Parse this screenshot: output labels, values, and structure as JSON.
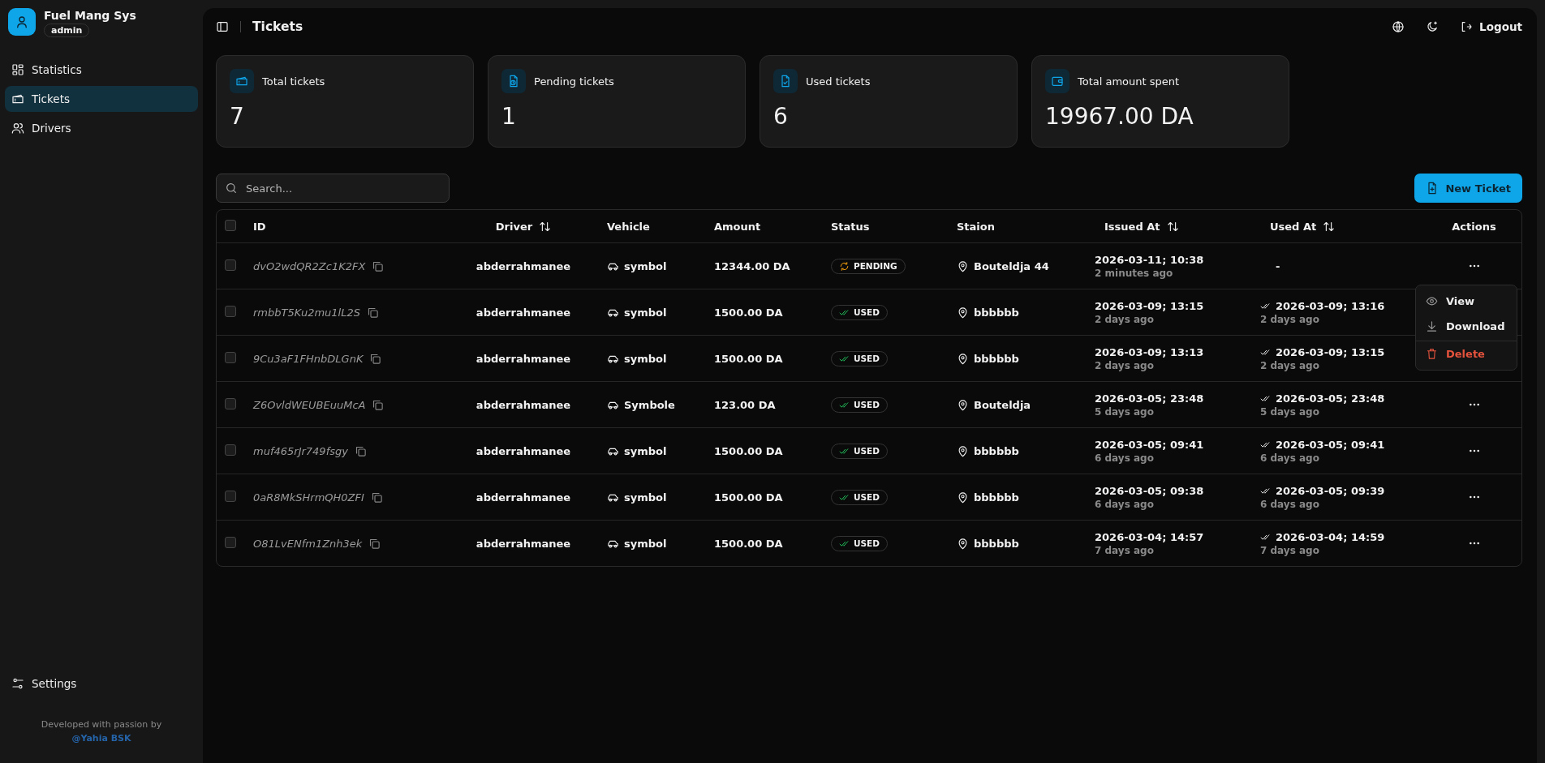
{
  "app": {
    "title": "Fuel Mang Sys",
    "role": "admin"
  },
  "sidebar": {
    "items": [
      {
        "label": "Statistics",
        "kind": "grid",
        "selected": false
      },
      {
        "label": "Tickets",
        "kind": "ticket",
        "selected": true
      },
      {
        "label": "Drivers",
        "kind": "users",
        "selected": false
      }
    ],
    "settings": "Settings",
    "footer": "Developed with passion by",
    "footer_link": "@Yahia BSK"
  },
  "header": {
    "title": "Tickets",
    "logout": "Logout"
  },
  "stats": [
    {
      "label": "Total tickets",
      "value": "7",
      "kind": "ticket"
    },
    {
      "label": "Pending tickets",
      "value": "1",
      "kind": "pending"
    },
    {
      "label": "Used tickets",
      "value": "6",
      "kind": "used"
    },
    {
      "label": "Total amount spent",
      "value": "19967.00 DA",
      "kind": "wallet"
    }
  ],
  "search": {
    "placeholder": "Search..."
  },
  "new_button": "New Ticket",
  "table": {
    "all_checked": false,
    "columns": [
      {
        "label": "ID",
        "sortable": false
      },
      {
        "label": "Driver",
        "sortable": true
      },
      {
        "label": "Vehicle",
        "sortable": false
      },
      {
        "label": "Amount",
        "sortable": false
      },
      {
        "label": "Status",
        "sortable": false
      },
      {
        "label": "Staion",
        "sortable": false
      },
      {
        "label": "Issued At",
        "sortable": true
      },
      {
        "label": "Used At",
        "sortable": true
      },
      {
        "label": "Actions",
        "sortable": false
      }
    ],
    "rows": [
      {
        "checked": false,
        "id": "dvO2wdQR2Zc1K2FX",
        "driver": "abderrahmanee",
        "vehicle": "symbol",
        "amount": "12344.00 DA",
        "status": {
          "kind": "pending",
          "label": "PENDING"
        },
        "station": "Bouteldja 44",
        "issued": "2026-03-11; 10:38",
        "issued_ago": "2 minutes ago",
        "used": "-",
        "used_ago": null,
        "menu_open": true
      },
      {
        "checked": false,
        "id": "rmbbT5Ku2mu1lL2S",
        "driver": "abderrahmanee",
        "vehicle": "symbol",
        "amount": "1500.00 DA",
        "status": {
          "kind": "used",
          "label": "USED"
        },
        "station": "bbbbbb",
        "issued": "2026-03-09; 13:15",
        "issued_ago": "2 days ago",
        "used": "2026-03-09; 13:16",
        "used_ago": "2 days ago",
        "menu_open": false
      },
      {
        "checked": false,
        "id": "9Cu3aF1FHnbDLGnK",
        "driver": "abderrahmanee",
        "vehicle": "symbol",
        "amount": "1500.00 DA",
        "status": {
          "kind": "used",
          "label": "USED"
        },
        "station": "bbbbbb",
        "issued": "2026-03-09; 13:13",
        "issued_ago": "2 days ago",
        "used": "2026-03-09; 13:15",
        "used_ago": "2 days ago",
        "menu_open": false
      },
      {
        "checked": false,
        "id": "Z6OvldWEUBEuuMcA",
        "driver": "abderrahmanee",
        "vehicle": "Symbole",
        "amount": "123.00 DA",
        "status": {
          "kind": "used",
          "label": "USED"
        },
        "station": "Bouteldja",
        "issued": "2026-03-05; 23:48",
        "issued_ago": "5 days ago",
        "used": "2026-03-05; 23:48",
        "used_ago": "5 days ago",
        "menu_open": false
      },
      {
        "checked": false,
        "id": "muf465rJr749fsgy",
        "driver": "abderrahmanee",
        "vehicle": "symbol",
        "amount": "1500.00 DA",
        "status": {
          "kind": "used",
          "label": "USED"
        },
        "station": "bbbbbb",
        "issued": "2026-03-05; 09:41",
        "issued_ago": "6 days ago",
        "used": "2026-03-05; 09:41",
        "used_ago": "6 days ago",
        "menu_open": false
      },
      {
        "checked": false,
        "id": "0aR8MkSHrmQH0ZFI",
        "driver": "abderrahmanee",
        "vehicle": "symbol",
        "amount": "1500.00 DA",
        "status": {
          "kind": "used",
          "label": "USED"
        },
        "station": "bbbbbb",
        "issued": "2026-03-05; 09:38",
        "issued_ago": "6 days ago",
        "used": "2026-03-05; 09:39",
        "used_ago": "6 days ago",
        "menu_open": false
      },
      {
        "checked": false,
        "id": "O81LvENfm1Znh3ek",
        "driver": "abderrahmanee",
        "vehicle": "symbol",
        "amount": "1500.00 DA",
        "status": {
          "kind": "used",
          "label": "USED"
        },
        "station": "bbbbbb",
        "issued": "2026-03-04; 14:57",
        "issued_ago": "7 days ago",
        "used": "2026-03-04; 14:59",
        "used_ago": "7 days ago",
        "menu_open": false
      }
    ]
  },
  "row_menu": [
    {
      "label": "View",
      "kind": "view"
    },
    {
      "label": "Download",
      "kind": "download"
    },
    {
      "label": "Delete",
      "kind": "delete"
    }
  ]
}
